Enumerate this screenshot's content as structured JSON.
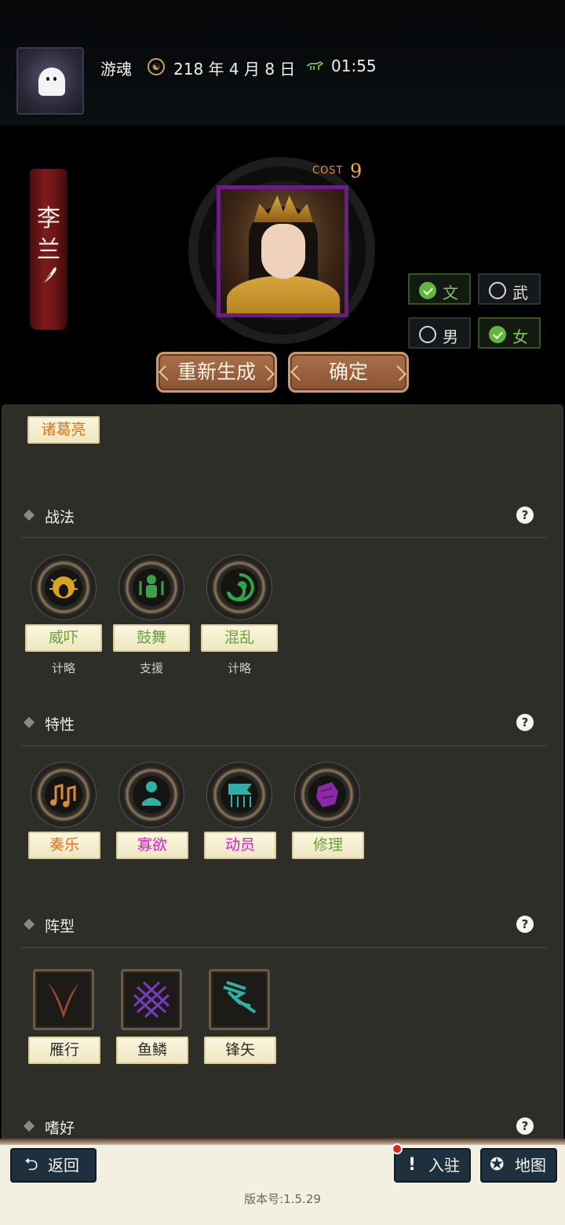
{
  "header": {
    "player_name": "游魂",
    "date": "218 年 4 月 8 日",
    "time": "01:55"
  },
  "hero": {
    "name_chars": [
      "李",
      "兰"
    ],
    "cost_label": "COST",
    "cost_value": "9",
    "type_options": [
      {
        "label": "文",
        "checked": true
      },
      {
        "label": "武",
        "checked": false
      }
    ],
    "gender_options": [
      {
        "label": "男",
        "checked": false
      },
      {
        "label": "女",
        "checked": true
      }
    ],
    "regenerate_label": "重新生成",
    "confirm_label": "确定"
  },
  "mentor_tag": "诸葛亮",
  "sections": {
    "tactics": {
      "title": "战法",
      "items": [
        {
          "name": "威吓",
          "category": "计略",
          "icon": "roar-icon",
          "color": "#6aa23a"
        },
        {
          "name": "鼓舞",
          "category": "支援",
          "icon": "cheer-icon",
          "color": "#6aa23a"
        },
        {
          "name": "混乱",
          "category": "计略",
          "icon": "swirl-icon",
          "color": "#6aa23a"
        }
      ]
    },
    "traits": {
      "title": "特性",
      "items": [
        {
          "name": "奏乐",
          "icon": "music-icon",
          "color": "#e8701a"
        },
        {
          "name": "寡欲",
          "icon": "meditate-icon",
          "color": "#e01ad0"
        },
        {
          "name": "动员",
          "icon": "banner-icon",
          "color": "#e01ad0"
        },
        {
          "name": "修理",
          "icon": "repair-icon",
          "color": "#6aa23a"
        }
      ]
    },
    "formations": {
      "title": "阵型",
      "items": [
        {
          "name": "雁行",
          "icon": "wing-formation-icon"
        },
        {
          "name": "鱼鳞",
          "icon": "scale-formation-icon"
        },
        {
          "name": "锋矢",
          "icon": "arrow-formation-icon"
        }
      ]
    },
    "hobbies": {
      "title": "嗜好"
    }
  },
  "bottom": {
    "back_label": "返回",
    "settle_label": "入驻",
    "map_label": "地图",
    "version": "版本号:1.5.29"
  }
}
